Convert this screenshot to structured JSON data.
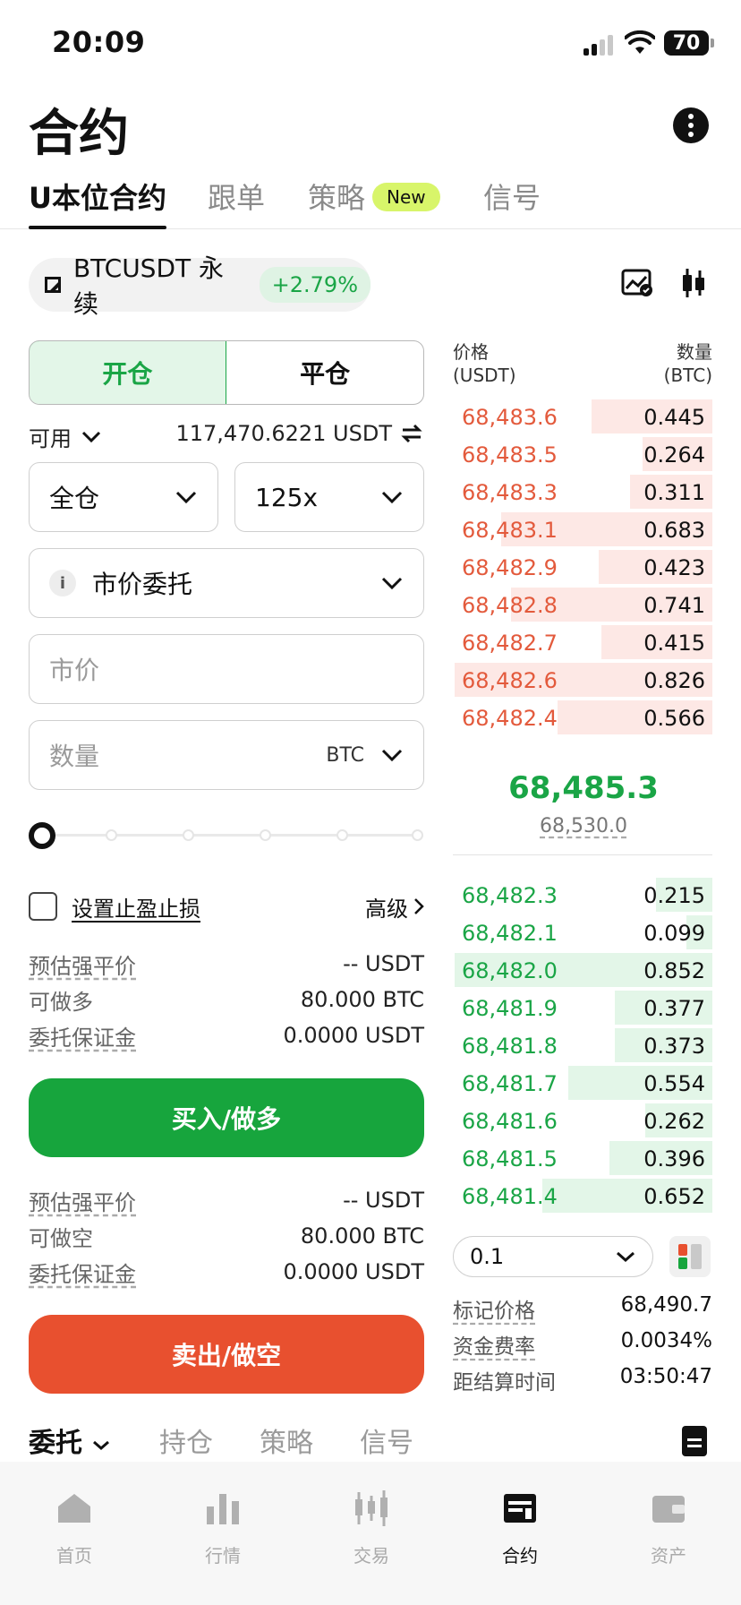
{
  "status": {
    "time": "20:09",
    "battery": "70"
  },
  "header": {
    "title": "合约"
  },
  "tabs": [
    {
      "label": "U本位合约",
      "active": true
    },
    {
      "label": "跟单",
      "active": false
    },
    {
      "label": "策略",
      "active": false,
      "badge": "New"
    },
    {
      "label": "信号",
      "active": false
    }
  ],
  "pair": {
    "name": "BTCUSDT 永续",
    "change": "+2.79%"
  },
  "form": {
    "open_label": "开仓",
    "close_label": "平仓",
    "available_label": "可用",
    "available_value": "117,470.6221 USDT",
    "margin_mode": "全仓",
    "leverage": "125x",
    "order_type": "市价委托",
    "order_type_info": "i",
    "price_placeholder": "市价",
    "qty_placeholder": "数量",
    "qty_unit": "BTC",
    "slider_percent": 0,
    "tpsl_label": "设置止盈止损",
    "advanced_label": "高级"
  },
  "buy_info": [
    {
      "k": "预估强平价",
      "v": "-- USDT"
    },
    {
      "k": "可做多",
      "v": "80.000 BTC"
    },
    {
      "k": "委托保证金",
      "v": "0.0000 USDT"
    }
  ],
  "buy_button": "买入/做多",
  "sell_info": [
    {
      "k": "预估强平价",
      "v": "-- USDT"
    },
    {
      "k": "可做空",
      "v": "80.000 BTC"
    },
    {
      "k": "委托保证金",
      "v": "0.0000 USDT"
    }
  ],
  "sell_button": "卖出/做空",
  "orderbook": {
    "price_header": "价格",
    "price_unit": "(USDT)",
    "qty_header": "数量",
    "qty_unit": "(BTC)",
    "asks": [
      {
        "price": "68,483.6",
        "qty": "0.445",
        "depth": 0.47
      },
      {
        "price": "68,483.5",
        "qty": "0.264",
        "depth": 0.27
      },
      {
        "price": "68,483.3",
        "qty": "0.311",
        "depth": 0.32
      },
      {
        "price": "68,483.1",
        "qty": "0.683",
        "depth": 0.82
      },
      {
        "price": "68,482.9",
        "qty": "0.423",
        "depth": 0.44
      },
      {
        "price": "68,482.8",
        "qty": "0.741",
        "depth": 0.78
      },
      {
        "price": "68,482.7",
        "qty": "0.415",
        "depth": 0.43
      },
      {
        "price": "68,482.6",
        "qty": "0.826",
        "depth": 1.0
      },
      {
        "price": "68,482.4",
        "qty": "0.566",
        "depth": 0.6
      }
    ],
    "mid_price": "68,485.3",
    "mark_price": "68,530.0",
    "bids": [
      {
        "price": "68,482.3",
        "qty": "0.215",
        "depth": 0.22
      },
      {
        "price": "68,482.1",
        "qty": "0.099",
        "depth": 0.1
      },
      {
        "price": "68,482.0",
        "qty": "0.852",
        "depth": 1.0
      },
      {
        "price": "68,481.9",
        "qty": "0.377",
        "depth": 0.38
      },
      {
        "price": "68,481.8",
        "qty": "0.373",
        "depth": 0.38
      },
      {
        "price": "68,481.7",
        "qty": "0.554",
        "depth": 0.56
      },
      {
        "price": "68,481.6",
        "qty": "0.262",
        "depth": 0.26
      },
      {
        "price": "68,481.5",
        "qty": "0.396",
        "depth": 0.4
      },
      {
        "price": "68,481.4",
        "qty": "0.652",
        "depth": 0.66
      }
    ],
    "depth_step": "0.1"
  },
  "stats": [
    {
      "k": "标记价格",
      "v": "68,490.7",
      "underline": true
    },
    {
      "k": "资金费率",
      "v": "0.0034%",
      "underline": true
    },
    {
      "k": "距结算时间",
      "v": "03:50:47",
      "underline": false
    }
  ],
  "bottom_tabs": [
    {
      "label": "委托",
      "active": true
    },
    {
      "label": "持仓",
      "active": false
    },
    {
      "label": "策略",
      "active": false
    },
    {
      "label": "信号",
      "active": false
    }
  ],
  "nav": [
    {
      "label": "首页",
      "icon": "home-icon",
      "active": false
    },
    {
      "label": "行情",
      "icon": "market-bars-icon",
      "active": false
    },
    {
      "label": "交易",
      "icon": "trade-candles-icon",
      "active": false
    },
    {
      "label": "合约",
      "icon": "futures-icon",
      "active": true
    },
    {
      "label": "资产",
      "icon": "wallet-icon",
      "active": false
    }
  ],
  "colors": {
    "buy": "#17a53d",
    "sell": "#e8502f",
    "badge": "#d8f56a"
  }
}
